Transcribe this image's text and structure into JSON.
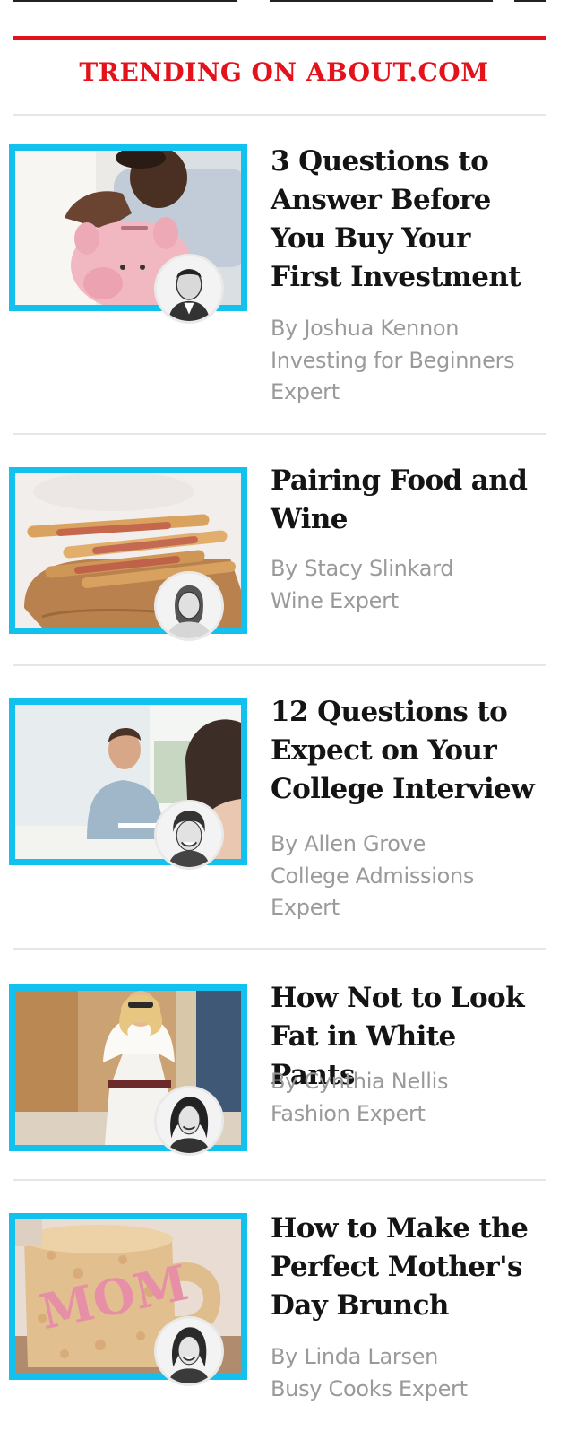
{
  "section": {
    "title": "TRENDING ON ABOUT.COM"
  },
  "colors": {
    "accent_red": "#e3121b",
    "highlight_blue": "#13c1ee",
    "byline_gray": "#9a9a9a"
  },
  "articles": [
    {
      "headline": "3 Questions to Answer Before You Buy Your First Investment",
      "author": "By Joshua Kennon",
      "role_lines": [
        "Investing for Beginners",
        "Expert"
      ],
      "thumbnail": "piggy-bank-photo"
    },
    {
      "headline": "Pairing Food and Wine",
      "author": "By Stacy Slinkard",
      "role_lines": [
        "Wine Expert"
      ],
      "thumbnail": "prosciutto-breadsticks-photo"
    },
    {
      "headline": "12 Questions to Expect on Your College Interview",
      "author": "By Allen Grove",
      "role_lines": [
        "College Admissions",
        "Expert"
      ],
      "thumbnail": "interview-photo"
    },
    {
      "headline": "How Not to Look Fat in White Pants",
      "author": "By Cynthia Nellis",
      "role_lines": [
        "Fashion Expert"
      ],
      "thumbnail": "white-pants-photo"
    },
    {
      "headline": "How to Make the Perfect Mother's Day Brunch",
      "author": "By Linda Larsen",
      "role_lines": [
        "Busy Cooks Expert"
      ],
      "thumbnail": "mom-mug-treat-photo"
    }
  ]
}
